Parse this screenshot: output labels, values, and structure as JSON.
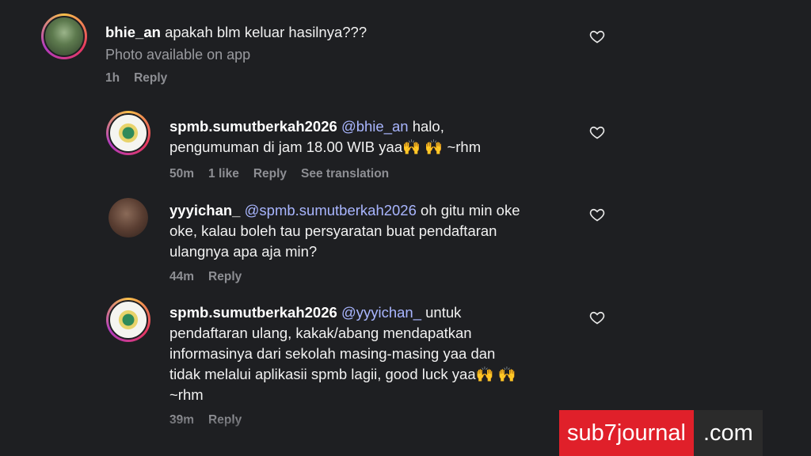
{
  "comments": [
    {
      "username": "bhie_an",
      "text": "apakah blm keluar hasilnya???",
      "photo_note": "Photo available on app",
      "time": "1h",
      "reply": "Reply"
    },
    {
      "username": "spmb.sumutberkah2026",
      "mention": "@bhie_an",
      "line1": "halo,",
      "line2": "pengumuman di jam 18.00 WIB yaa🙌 🙌  ~rhm",
      "time": "50m",
      "likes": "1 like",
      "reply": "Reply",
      "translate": "See translation"
    },
    {
      "username": "yyyichan_",
      "mention": "@spmb.sumutberkah2026",
      "line1": "oh gitu min oke",
      "line2": "oke, kalau boleh tau persyaratan buat pendaftaran",
      "line3": "ulangnya apa aja min?",
      "time": "44m",
      "reply": "Reply"
    },
    {
      "username": "spmb.sumutberkah2026",
      "mention": "@yyyichan_",
      "line1": "untuk",
      "line2": "pendaftaran ulang, kakak/abang mendapatkan",
      "line3": "informasinya dari sekolah masing-masing yaa dan",
      "line4": "tidak melalui aplikasii spmb lagii, good luck yaa🙌 🙌",
      "line5": "~rhm",
      "time": "39m",
      "reply": "Reply"
    }
  ],
  "watermark": {
    "brand": "sub7journal",
    "tld": ".com"
  },
  "colors": {
    "background": "#1e1f22",
    "mention": "#a9b6ff",
    "watermark_red": "#e0202a"
  }
}
